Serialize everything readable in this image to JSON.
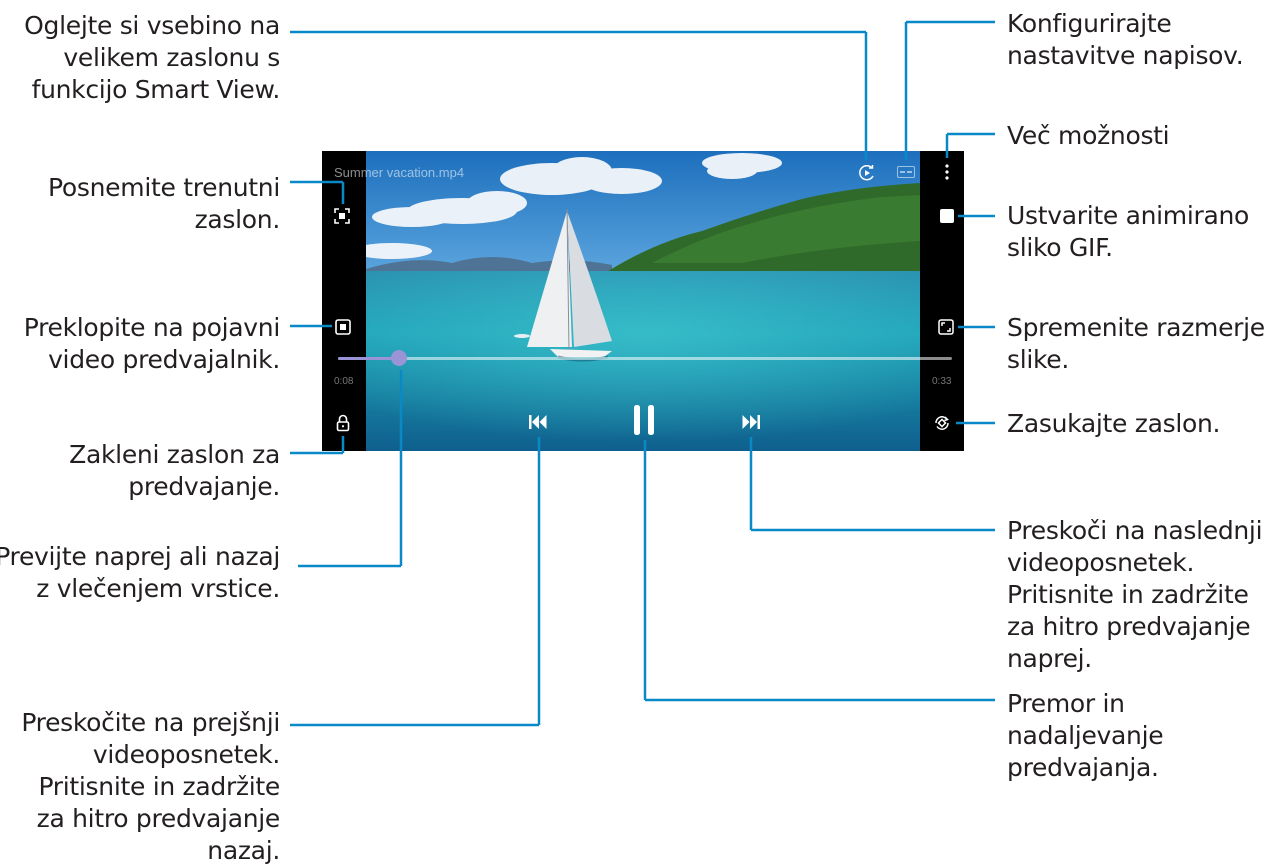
{
  "callouts": {
    "smart_view": "Oglejte si vsebino na velikem zaslonu s funkcijo Smart View.",
    "capture": "Posnemite trenutni zaslon.",
    "popup": "Preklopite na pojavni video predvajalnik.",
    "lock": "Zakleni zaslon za predvajanje.",
    "seek": "Previjte naprej ali nazaj z vlečenjem vrstice.",
    "previous": "Preskočite na prejšnji videoposnetek. Pritisnite in zadržite za hitro predvajanje nazaj.",
    "captions": "Konfigurirajte nastavitve napisov.",
    "more": "Več možnosti",
    "gif": "Ustvarite animirano sliko GIF.",
    "ratio": "Spremenite razmerje slike.",
    "rotate": "Zasukajte zaslon.",
    "next": "Preskoči na naslednji videoposnetek. Pritisnite in zadržite za hitro predvajanje naprej.",
    "pause": "Premor in nadaljevanje predvajanja."
  },
  "player": {
    "title": "Summer vacation.mp4",
    "elapsed": "0:08",
    "remaining": "0:33",
    "progress_fraction": 0.1
  },
  "colors": {
    "leader": "#0a89c8",
    "seek_accent": "#9a93d6",
    "text": "#231f20"
  },
  "icons": [
    "smart-view-icon",
    "captions-icon",
    "more-options-icon",
    "capture-icon",
    "gif-icon",
    "popup-player-icon",
    "aspect-ratio-icon",
    "lock-icon",
    "rotate-icon",
    "previous-icon",
    "pause-icon",
    "next-icon"
  ]
}
